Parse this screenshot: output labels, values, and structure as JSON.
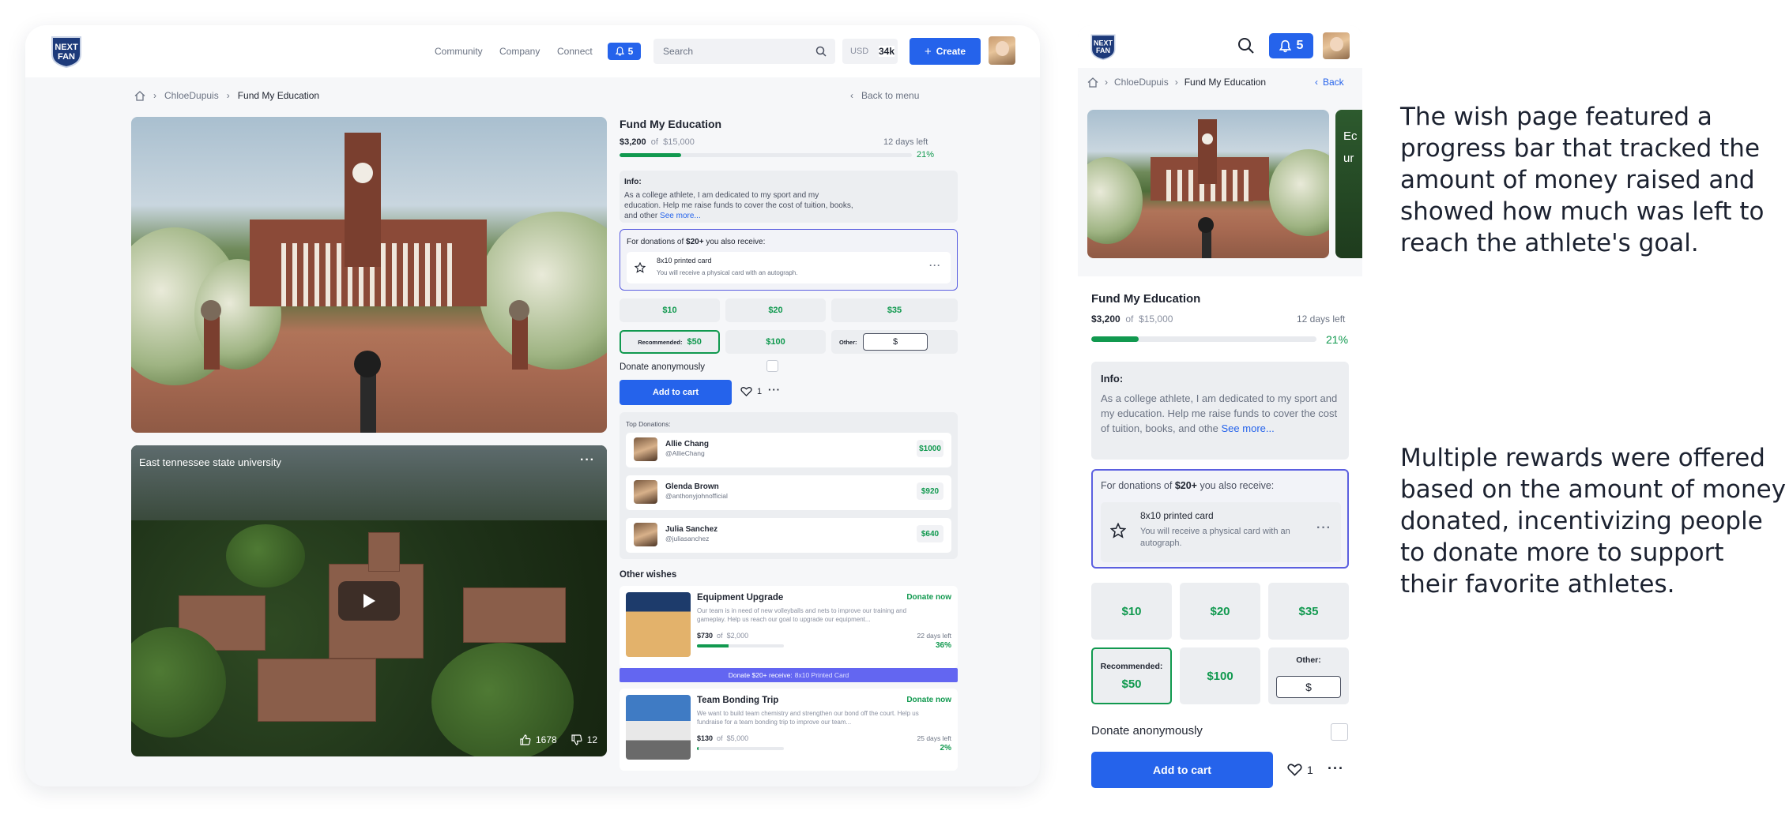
{
  "brand": {
    "logo_text": "NEXT FAN"
  },
  "nav": {
    "links": [
      "Community",
      "Company",
      "Connect"
    ],
    "notifications": "5",
    "search_placeholder": "Search",
    "currency": "USD",
    "balance": "34k",
    "create_label": "Create"
  },
  "breadcrumb": {
    "user": "ChloeDupuis",
    "page": "Fund My Education",
    "back_desktop": "Back to menu",
    "back_mobile": "Back"
  },
  "video": {
    "title": "East tennessee state university",
    "likes": "1678",
    "dislikes": "12"
  },
  "wish": {
    "title": "Fund My Education",
    "raised": "$3,200",
    "of_label": "of",
    "goal": "$15,000",
    "days_left": "12 days left",
    "percent_label": "21%",
    "progress": 0.21,
    "info_label": "Info:",
    "info_desktop": "As a college athlete, I am dedicated to my sport and my education. Help me raise funds to cover the cost of tuition, books, and other",
    "info_mobile": "As a college athlete, I am dedicated to my sport and my education. Help me raise funds to cover the cost of tuition, books, and othe",
    "see_more": "See more...",
    "reward_prefix": "For donations of",
    "reward_amount": "$20+",
    "reward_suffix": "you also receive:",
    "reward_title": "8x10 printed card",
    "reward_desc": "You will receive a physical card with an autograph.",
    "amounts": [
      "$10",
      "$20",
      "$35"
    ],
    "recommended_label": "Recommended:",
    "recommended_amount": "$50",
    "amount_100": "$100",
    "other_label": "Other:",
    "other_value": "$",
    "anonymous_label": "Donate anonymously",
    "cart_label": "Add to cart",
    "like_count": "1"
  },
  "top_donations": {
    "label": "Top Donations:",
    "items": [
      {
        "name": "Allie Chang",
        "handle": "@AllieChang",
        "amount": "$1000"
      },
      {
        "name": "Glenda Brown",
        "handle": "@anthonyjohnofficial",
        "amount": "$920"
      },
      {
        "name": "Julia Sanchez",
        "handle": "@juliasanchez",
        "amount": "$640"
      }
    ]
  },
  "other_wishes": {
    "label": "Other wishes",
    "items": [
      {
        "title": "Equipment Upgrade",
        "action": "Donate now",
        "desc": "Our team is in need of new volleyballs and nets to improve our training and gameplay. Help us reach our goal to upgrade our equipment...",
        "raised": "$730",
        "of_label": "of",
        "goal": "$2,000",
        "days_left": "22 days left",
        "percent_label": "36%",
        "progress": 0.36
      },
      {
        "title": "Team Bonding Trip",
        "action": "Donate now",
        "desc": "We want to build team chemistry and strengthen our bond off the court. Help us fundraise for a team bonding trip to improve our team...",
        "raised": "$130",
        "of_label": "of",
        "goal": "$5,000",
        "days_left": "25 days left",
        "percent_label": "2%",
        "progress": 0.02
      }
    ],
    "promo_prefix": "Donate $20+ receive:",
    "promo_reward": "8x10 Printed Card"
  },
  "mobile": {
    "next_card_text": "Ec",
    "next_card_text2": "ur"
  },
  "captions": {
    "first": "The wish page featured a progress bar that tracked the amount of money raised and showed how much was left to reach the athlete's goal.",
    "second": "Multiple rewards were offered based on the amount of money donated, incentivizing people to donate more to support their favorite athletes."
  },
  "colors": {
    "primary": "#2563eb",
    "success": "#11994f",
    "reward_border": "#5b5fe0",
    "promo": "#6366f1"
  }
}
